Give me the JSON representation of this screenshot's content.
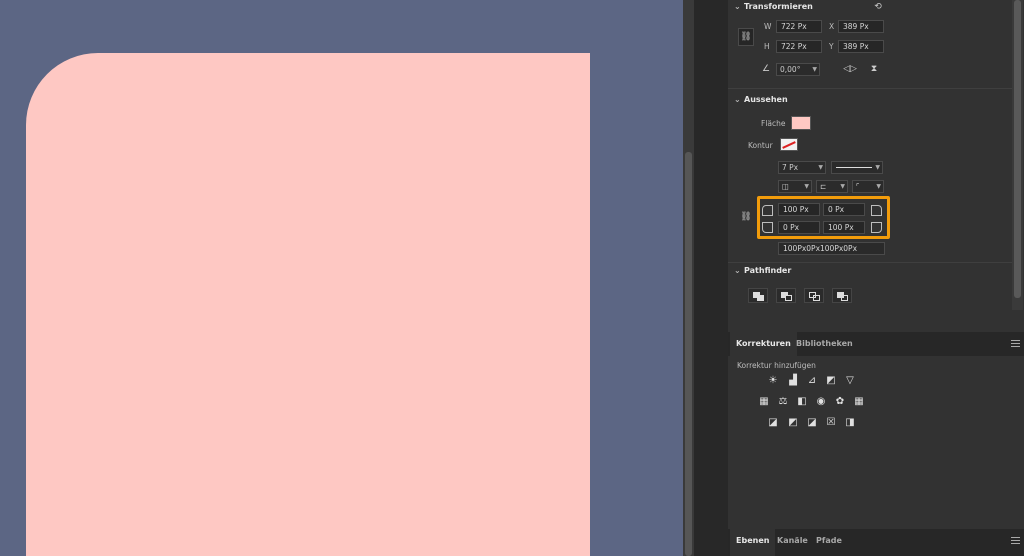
{
  "transform": {
    "title": "Transformieren",
    "w_label": "W",
    "w_value": "722 Px",
    "h_label": "H",
    "h_value": "722 Px",
    "x_label": "X",
    "x_value": "389 Px",
    "y_label": "Y",
    "y_value": "389 Px",
    "angle_value": "0,00°"
  },
  "appearance": {
    "title": "Aussehen",
    "fill_label": "Fläche",
    "fill_color": "#fec8c3",
    "stroke_label": "Kontur",
    "stroke_width": "7 Px",
    "corner_tl": "100 Px",
    "corner_tr": "0 Px",
    "corner_bl": "0 Px",
    "corner_br": "100 Px",
    "corner_summary": "100Px0Px100Px0Px"
  },
  "pathfinder": {
    "title": "Pathfinder"
  },
  "adjustments": {
    "tabs": [
      "Korrekturen",
      "Bibliotheken"
    ],
    "add_label": "Korrektur hinzufügen"
  },
  "layers_tabs": [
    "Ebenen",
    "Kanäle",
    "Pfade"
  ],
  "colors": {
    "canvas_bg": "#5c6684",
    "shape_fill": "#fec8c3",
    "highlight": "#f29c0b"
  }
}
